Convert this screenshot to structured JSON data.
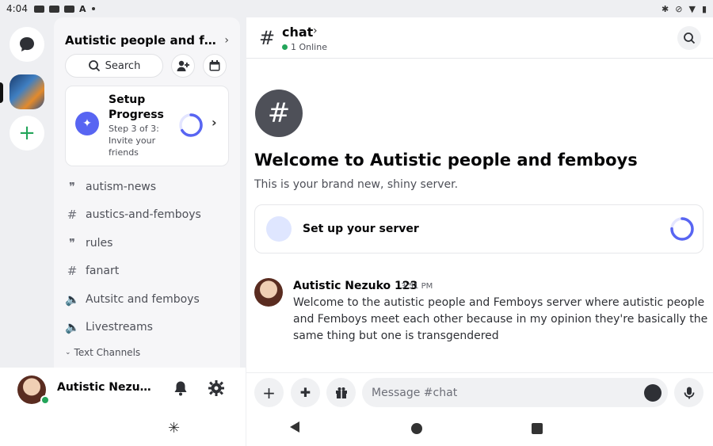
{
  "status_bar": {
    "time": "4:04"
  },
  "server": {
    "name": "Autistic people and fem...",
    "search_label": "Search",
    "setup_progress": {
      "title": "Setup Progress",
      "subtitle": "Step 3 of 3: Invite your friends",
      "progress": 0.66
    },
    "channels": [
      {
        "icon": "forum-icon",
        "label": "autism-news"
      },
      {
        "icon": "hash-icon",
        "label": "austics-and-femboys"
      },
      {
        "icon": "forum-icon",
        "label": "rules"
      },
      {
        "icon": "hash-icon",
        "label": "fanart"
      },
      {
        "icon": "speaker-icon",
        "label": "Autsitc and femboys"
      },
      {
        "icon": "speaker-icon",
        "label": "Livestreams"
      }
    ],
    "category": "Text Channels"
  },
  "user": {
    "name": "Autistic Nezuko ..."
  },
  "chat": {
    "channel_name": "chat",
    "online": "1 Online",
    "welcome_title": "Welcome to Autistic people and femboys",
    "welcome_sub": "This is your brand new, shiny server.",
    "setup_label": "Set up your server",
    "setup_progress": 0.75,
    "message": {
      "author": "Autistic Nezuko 123",
      "time": "3:51 PM",
      "text": "Welcome to the autistic people and Femboys server where autistic people and Femboys meet each other because in my opinion they're basically the same thing but one is transgendered"
    },
    "composer_placeholder": "Message #chat"
  }
}
